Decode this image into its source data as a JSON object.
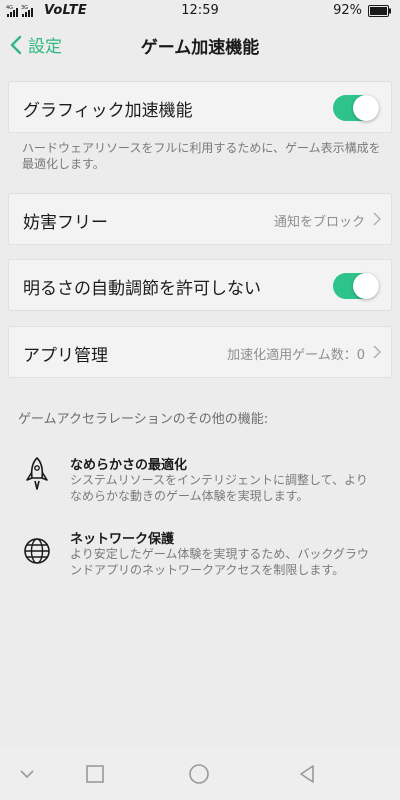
{
  "status_bar": {
    "signal": "4G 3G",
    "network": "VoLTE",
    "time": "12:59",
    "battery": "92%"
  },
  "header": {
    "back_label": "設定",
    "title": "ゲーム加速機能"
  },
  "settings": {
    "graphics_accel": {
      "label": "グラフィック加速機能",
      "enabled": true,
      "description": "ハードウェアリソースをフルに利用するために、ゲーム表示構成を最適化します。"
    },
    "disturb_free": {
      "label": "妨害フリー",
      "value": "通知をブロック"
    },
    "brightness": {
      "label": "明るさの自動調節を許可しない",
      "enabled": true
    },
    "app_management": {
      "label": "アプリ管理",
      "value": "加速化適用ゲーム数：0"
    }
  },
  "other_features": {
    "header": "ゲームアクセラレーションのその他の機能:",
    "items": [
      {
        "icon": "rocket-icon",
        "title": "なめらかさの最適化",
        "description": "システムリソースをインテリジェントに調整して、よりなめらかな動きのゲーム体験を実現します。"
      },
      {
        "icon": "globe-icon",
        "title": "ネットワーク保護",
        "description": "より安定したゲーム体験を実現するため、バックグラウンドアプリのネットワークアクセスを制限します。"
      }
    ]
  },
  "colors": {
    "accent": "#2eb882",
    "toggle_on": "#2ec38b",
    "background": "#ececec"
  }
}
